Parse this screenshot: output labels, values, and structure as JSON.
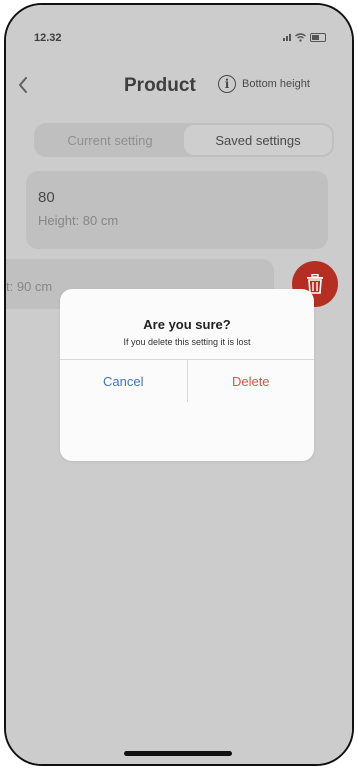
{
  "status_bar": {
    "time": "12.32",
    "icons": [
      "signal-icon",
      "wifi-icon",
      "battery-icon"
    ]
  },
  "header": {
    "back_label": "<",
    "title": "Product",
    "info_label": "Bottom height",
    "icons": {
      "back": "chevron-left-icon",
      "info": "info-icon"
    }
  },
  "segmented": {
    "tabs": [
      {
        "label": "Current setting",
        "active": false
      },
      {
        "label": "Saved settings",
        "active": true
      }
    ]
  },
  "settings": [
    {
      "value": "80",
      "subtitle": "Height: 80 cm"
    },
    {
      "value": "",
      "subtitle": "t: 90 cm"
    }
  ],
  "delete_fab": {
    "icon": "trash-icon",
    "color": "#b42f22"
  },
  "dialog": {
    "title": "Are you sure?",
    "message": "If you delete this setting it is lost",
    "cancel_label": "Cancel",
    "delete_label": "Delete",
    "cancel_color": "#3f73c8",
    "delete_color": "#e05345"
  }
}
